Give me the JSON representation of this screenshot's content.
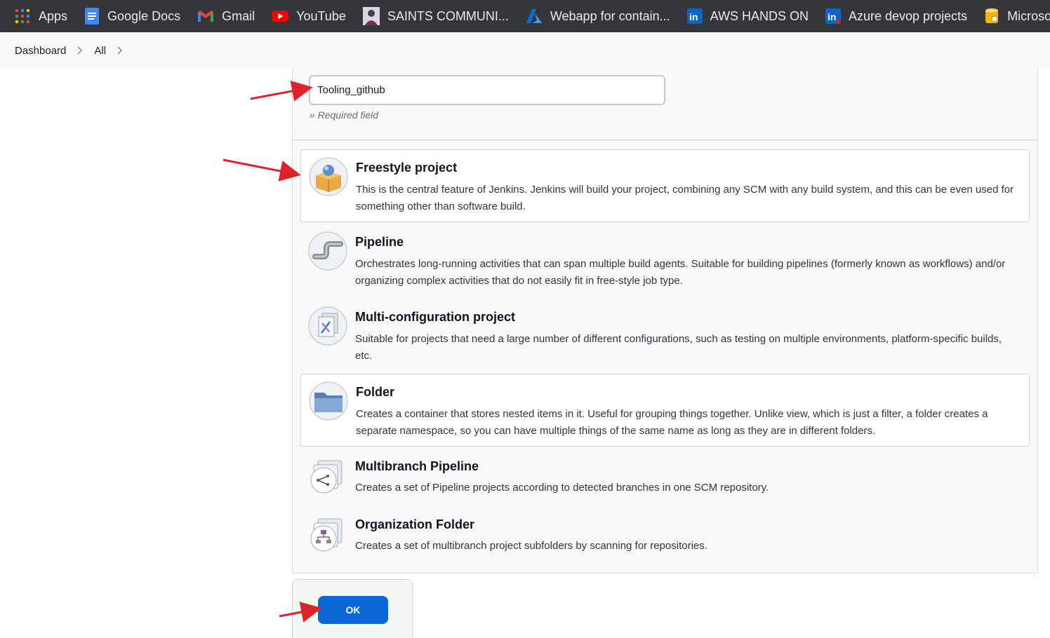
{
  "bookmarks": [
    {
      "label": "Apps",
      "icon": "apps-grid-icon"
    },
    {
      "label": "Google Docs",
      "icon": "google-docs-icon"
    },
    {
      "label": "Gmail",
      "icon": "gmail-icon"
    },
    {
      "label": "YouTube",
      "icon": "youtube-icon"
    },
    {
      "label": "SAINTS COMMUNI...",
      "icon": "saints-avatar-icon"
    },
    {
      "label": "Webapp for contain...",
      "icon": "azure-icon"
    },
    {
      "label": "AWS HANDS ON",
      "icon": "linkedin-icon"
    },
    {
      "label": "Azure devop projects",
      "icon": "linkedin-icon"
    },
    {
      "label": "Microso",
      "icon": "database-icon"
    }
  ],
  "breadcrumb": [
    "Dashboard",
    "All"
  ],
  "form": {
    "item_name": "Tooling_github",
    "required_note": "» Required field"
  },
  "item_types": [
    {
      "title": "Freestyle project",
      "description": "This is the central feature of Jenkins. Jenkins will build your project, combining any SCM with any build system, and this can be even used for something other than software build.",
      "icon": "freestyle-box-icon",
      "boxed": true
    },
    {
      "title": "Pipeline",
      "description": "Orchestrates long-running activities that can span multiple build agents. Suitable for building pipelines (formerly known as workflows) and/or organizing complex activities that do not easily fit in free-style job type.",
      "icon": "pipeline-pipe-icon",
      "boxed": false
    },
    {
      "title": "Multi-configuration project",
      "description": "Suitable for projects that need a large number of different configurations, such as testing on multiple environments, platform-specific builds, etc.",
      "icon": "multi-config-icon",
      "boxed": false
    },
    {
      "title": "Folder",
      "description": "Creates a container that stores nested items in it. Useful for grouping things together. Unlike view, which is just a filter, a folder creates a separate namespace, so you can have multiple things of the same name as long as they are in different folders.",
      "icon": "folder-icon",
      "boxed": true
    },
    {
      "title": "Multibranch Pipeline",
      "description": "Creates a set of Pipeline projects according to detected branches in one SCM repository.",
      "icon": "multibranch-icon",
      "boxed": false
    },
    {
      "title": "Organization Folder",
      "description": "Creates a set of multibranch project subfolders by scanning for repositories.",
      "icon": "organization-folder-icon",
      "boxed": false
    }
  ],
  "ok_label": "OK",
  "colors": {
    "ok_button": "#0b66d6",
    "annotation_arrow": "#e0232b",
    "bookmarks_bar": "#35363a"
  }
}
